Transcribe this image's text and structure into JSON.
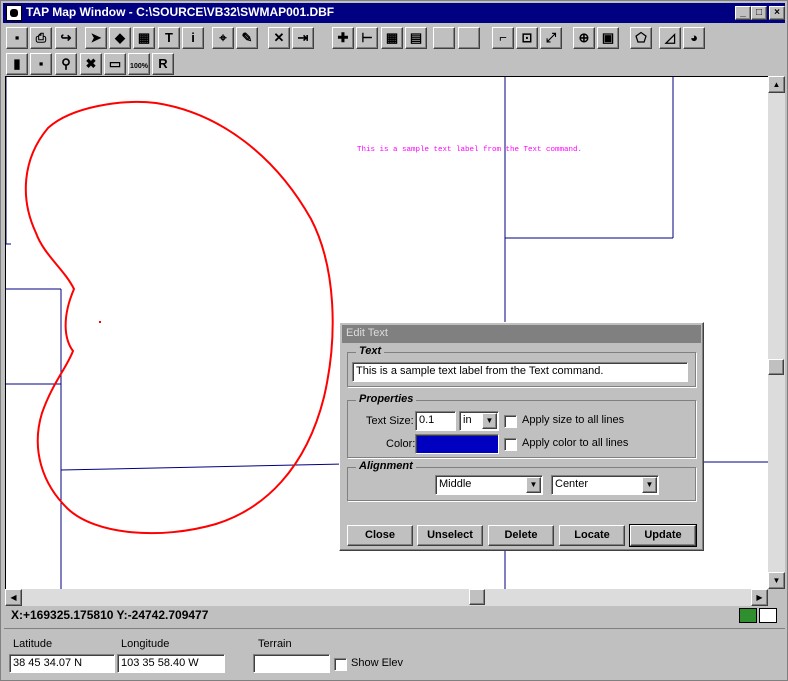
{
  "window": {
    "title": "TAP Map Window - C:\\SOURCE\\VB32\\SWMAP001.DBF",
    "min_glyph": "_",
    "max_glyph": "□",
    "close_glyph": "×"
  },
  "toolbar1": [
    {
      "name": "save-icon",
      "glyph": "▪"
    },
    {
      "name": "print-icon",
      "glyph": "⎙"
    },
    {
      "name": "redo-arrow-icon",
      "glyph": "↪"
    },
    {
      "name": "pointer-icon",
      "glyph": "➤"
    },
    {
      "name": "shapes-icon",
      "glyph": "◆"
    },
    {
      "name": "calculator-icon",
      "glyph": "▦"
    },
    {
      "name": "text-tool-icon",
      "glyph": "T"
    },
    {
      "name": "info-icon",
      "glyph": "i"
    },
    {
      "name": "node-tool-icon",
      "glyph": "⌖"
    },
    {
      "name": "wrench-icon",
      "glyph": "✎"
    },
    {
      "name": "delete-x-icon",
      "glyph": "✕"
    },
    {
      "name": "exit-door-icon",
      "glyph": "⇥"
    },
    {
      "name": "add-point-icon",
      "glyph": "✚"
    },
    {
      "name": "ruler-icon",
      "glyph": "⊢"
    },
    {
      "name": "grid-icon",
      "glyph": "▦"
    },
    {
      "name": "notepad-icon",
      "glyph": "▤"
    },
    {
      "name": "blank-button-1",
      "glyph": ""
    },
    {
      "name": "blank-button-2",
      "glyph": ""
    },
    {
      "name": "crop-icon",
      "glyph": "⌐"
    },
    {
      "name": "zoom-window-icon",
      "glyph": "⊡"
    },
    {
      "name": "resize-icon",
      "glyph": "⤢"
    },
    {
      "name": "pan-crosshair-icon",
      "glyph": "⊕"
    },
    {
      "name": "layers-icon",
      "glyph": "▣"
    },
    {
      "name": "polygon-icon",
      "glyph": "⬠"
    },
    {
      "name": "area-chart-icon",
      "glyph": "◿"
    },
    {
      "name": "pie-chart-icon",
      "glyph": "◕"
    }
  ],
  "toolbar2": [
    {
      "name": "green-map-icon",
      "glyph": "▮"
    },
    {
      "name": "green-small-icon",
      "glyph": "▪"
    },
    {
      "name": "magnifier-icon",
      "glyph": "⚲"
    },
    {
      "name": "red-x-icon",
      "glyph": "✖"
    },
    {
      "name": "monitor-icon",
      "glyph": "▭"
    },
    {
      "name": "zoom-100-icon",
      "glyph": "100%"
    },
    {
      "name": "yellow-r-icon",
      "glyph": "R"
    }
  ],
  "map": {
    "label": "This is a sample text label from the Text command.",
    "label_color": "#ff00ff",
    "boundary_color": "#ff0000",
    "line_color": "#000080"
  },
  "scrollbars": {
    "up": "▲",
    "down": "▼",
    "left": "◀",
    "right": "▶"
  },
  "status": {
    "coords": "X:+169325.175810 Y:-24742.709477"
  },
  "bottom": {
    "latitude_label": "Latitude",
    "latitude_value": "38 45 34.07 N",
    "longitude_label": "Longitude",
    "longitude_value": "103 35 58.40 W",
    "terrain_label": "Terrain",
    "terrain_value": "",
    "show_elev_label": "Show Elev"
  },
  "dialog": {
    "title": "Edit Text",
    "text_group": "Text",
    "text_value": "This is a sample text label from the Text command.",
    "props_group": "Properties",
    "text_size_label": "Text Size:",
    "text_size_value": "0.1",
    "unit_value": "in",
    "apply_size_label": "Apply size to all lines",
    "color_label": "Color:",
    "color_value": "#0000c0",
    "apply_color_label": "Apply color to all lines",
    "align_group": "Alignment",
    "vertical_align": "Middle",
    "horizontal_align": "Center",
    "buttons": {
      "close": "Close",
      "unselect": "Unselect",
      "delete": "Delete",
      "locate": "Locate",
      "update": "Update"
    },
    "combo_glyph": "▼"
  }
}
